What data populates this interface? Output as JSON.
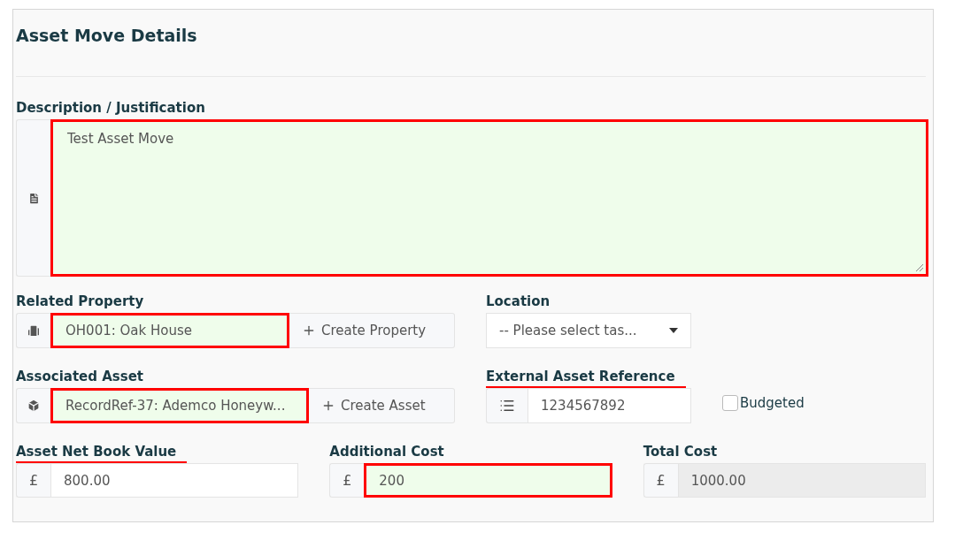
{
  "panel": {
    "title": "Asset Move Details"
  },
  "description": {
    "label": "Description / Justification",
    "value": "Test Asset Move",
    "highlighted": true,
    "filled": true
  },
  "rows": [
    {
      "fields": [
        {
          "kind": "lookup",
          "label": "Related Property",
          "underlined": false,
          "value": "OH001: Oak House",
          "highlighted": true,
          "filled": true,
          "button": "Create Property"
        },
        {
          "kind": "select",
          "label": "Location",
          "underlined": false,
          "value": "-- Please select tas..."
        }
      ]
    },
    {
      "fields": [
        {
          "kind": "lookup",
          "label": "Associated Asset",
          "underlined": false,
          "value": "RecordRef-37: Ademco Honeyw...",
          "highlighted": true,
          "filled": true,
          "button": "Create Asset"
        },
        {
          "kind": "text",
          "label": "External Asset Reference",
          "underlined": true,
          "value": "1234567892"
        },
        {
          "kind": "checkbox",
          "label": "Budgeted",
          "checked": false
        }
      ]
    },
    {
      "fields": [
        {
          "kind": "currency",
          "label": "Asset Net Book Value",
          "underlined": true,
          "symbol": "£",
          "value": "800.00",
          "highlighted": false,
          "filled": false,
          "disabled": false
        },
        {
          "kind": "currency",
          "label": "Additional Cost",
          "underlined": false,
          "symbol": "£",
          "value": "200",
          "highlighted": true,
          "filled": true,
          "disabled": false
        },
        {
          "kind": "currency",
          "label": "Total Cost",
          "underlined": false,
          "symbol": "£",
          "value": "1000.00",
          "highlighted": false,
          "filled": false,
          "disabled": true
        }
      ]
    }
  ]
}
